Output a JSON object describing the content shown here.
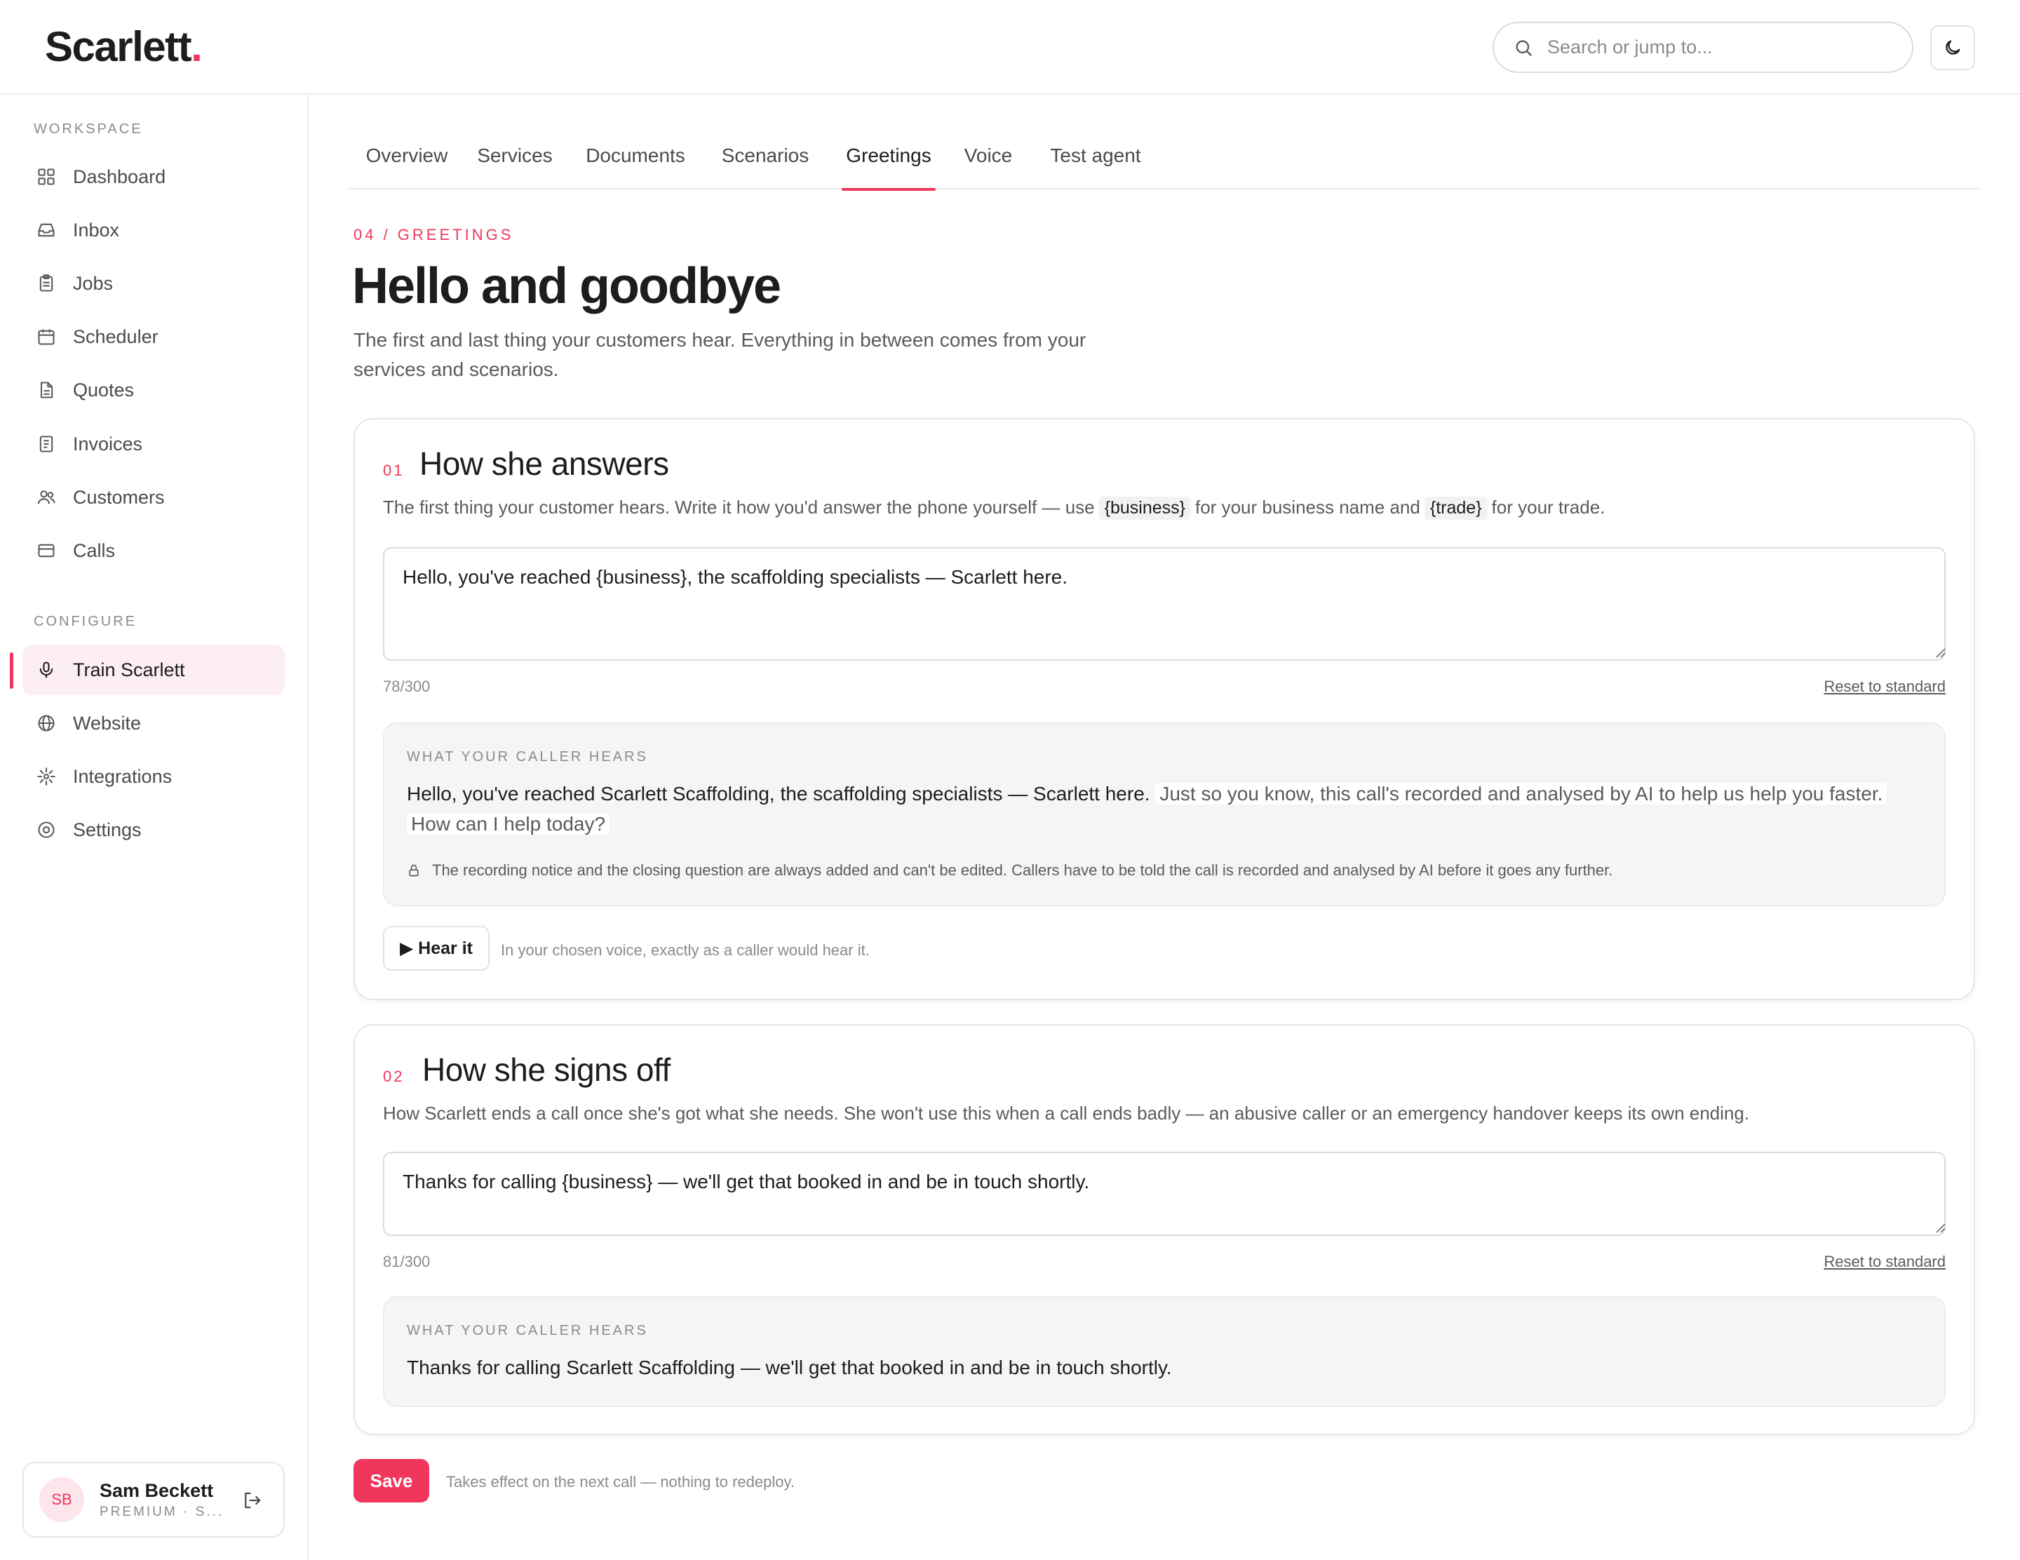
{
  "app": {
    "logo_text": "Scarlett",
    "logo_dot": ".",
    "accent": "#f0365a"
  },
  "search": {
    "placeholder": "Search or jump to...",
    "icon": "search-icon"
  },
  "theme_toggle": {
    "icon": "moon-icon"
  },
  "sidebar": {
    "workspace_label": "WORKSPACE",
    "workspace_items": [
      {
        "label": "Dashboard",
        "icon": "grid-icon"
      },
      {
        "label": "Inbox",
        "icon": "inbox-icon"
      },
      {
        "label": "Jobs",
        "icon": "clipboard-icon"
      },
      {
        "label": "Scheduler",
        "icon": "calendar-icon"
      },
      {
        "label": "Quotes",
        "icon": "file-icon"
      },
      {
        "label": "Invoices",
        "icon": "receipt-icon"
      },
      {
        "label": "Customers",
        "icon": "users-icon"
      },
      {
        "label": "Calls",
        "icon": "phone-card-icon"
      }
    ],
    "configure_label": "CONFIGURE",
    "configure_items": [
      {
        "label": "Train Scarlett",
        "icon": "mic-icon",
        "active": true
      },
      {
        "label": "Website",
        "icon": "globe-icon"
      },
      {
        "label": "Integrations",
        "icon": "sparkle-icon"
      },
      {
        "label": "Settings",
        "icon": "settings-icon"
      }
    ],
    "user": {
      "initials": "SB",
      "name": "Sam Beckett",
      "plan": "PREMIUM · S..."
    }
  },
  "tabs": [
    "Overview",
    "Services",
    "Documents",
    "Scenarios",
    "Greetings",
    "Voice",
    "Test agent"
  ],
  "active_tab": "Greetings",
  "page": {
    "eyebrow": "04 / GREETINGS",
    "title": "Hello and goodbye",
    "subtitle": "The first and last thing your customers hear. Everything in between comes from your services and scenarios."
  },
  "answer_card": {
    "num": "01",
    "title": "How she answers",
    "desc_before": "The first thing your customer hears. Write it how you'd answer the phone yourself — use",
    "chip_business": "{business}",
    "desc_middle": "for your business name and",
    "chip_trade": "{trade}",
    "desc_after": "for your trade.",
    "value": "Hello, you've reached {business}, the scaffolding specialists — Scarlett here.",
    "counter": "78/300",
    "reset": "Reset to standard",
    "preview_label": "WHAT YOUR CALLER HEARS",
    "preview_main": "Hello, you've reached Scarlett Scaffolding, the scaffolding specialists — Scarlett here.",
    "preview_notice": "Just so you know, this call's recorded and analysed by AI to help us help you faster.",
    "preview_question": "How can I help today?",
    "lock_note": "The recording notice and the closing question are always added and can't be edited. Callers have to be told the call is recorded and analysed by AI before it goes any further.",
    "hear_button": "▶ Hear it",
    "hear_hint": "In your chosen voice, exactly as a caller would hear it."
  },
  "signoff_card": {
    "num": "02",
    "title": "How she signs off",
    "desc": "How Scarlett ends a call once she's got what she needs. She won't use this when a call ends badly — an abusive caller or an emergency handover keeps its own ending.",
    "value": "Thanks for calling {business} — we'll get that booked in and be in touch shortly.",
    "counter": "81/300",
    "reset": "Reset to standard",
    "preview_label": "WHAT YOUR CALLER HEARS",
    "preview_main": "Thanks for calling Scarlett Scaffolding — we'll get that booked in and be in touch shortly."
  },
  "footer": {
    "save": "Save",
    "hint": "Takes effect on the next call — nothing to redeploy."
  }
}
